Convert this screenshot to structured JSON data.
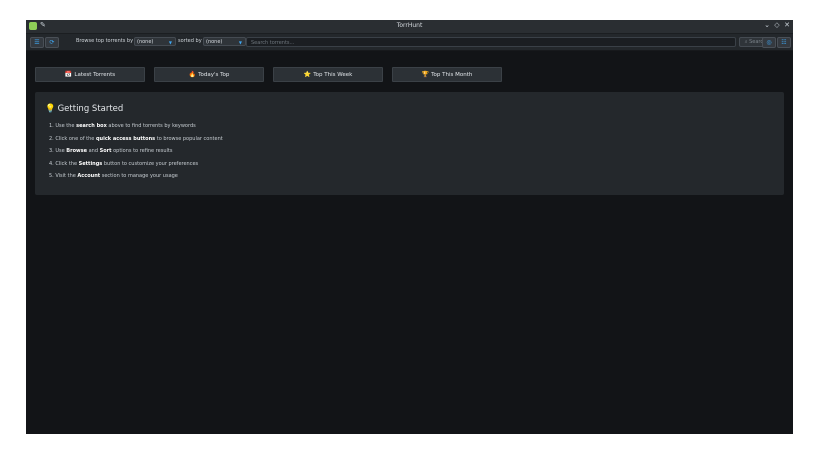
{
  "window": {
    "title": "TorrHunt"
  },
  "toolbar": {
    "browse_label": "Browse top torrents by",
    "browse_value": "(none)",
    "sort_label": "sorted by",
    "sort_value": "(none)",
    "search_placeholder": "Search torrents...",
    "search_button": "Search"
  },
  "quick_buttons": [
    {
      "label": "Latest Torrents",
      "icon": "📅"
    },
    {
      "label": "Today's Top",
      "icon": "🔥"
    },
    {
      "label": "Top This Week",
      "icon": "⭐"
    },
    {
      "label": "Top This Month",
      "icon": "🏆"
    }
  ],
  "getting_started": {
    "title": "Getting Started",
    "steps": [
      {
        "pre": "1. Use the ",
        "bold": "search box",
        "post": " above to find torrents by keywords"
      },
      {
        "pre": "2. Click one of the ",
        "bold": "quick access buttons",
        "post": " to browse popular content"
      },
      {
        "pre": "3. Use ",
        "bold": "Browse",
        "mid": " and ",
        "bold2": "Sort",
        "post": " options to refine results"
      },
      {
        "pre": "4. Click the ",
        "bold": "Settings",
        "post": " button to customize your preferences"
      },
      {
        "pre": "5. Visit the ",
        "bold": "Account",
        "post": " section to manage your usage"
      }
    ]
  },
  "colors": {
    "accent": "#3fa9f5",
    "background": "#121417",
    "card": "#24282c"
  }
}
